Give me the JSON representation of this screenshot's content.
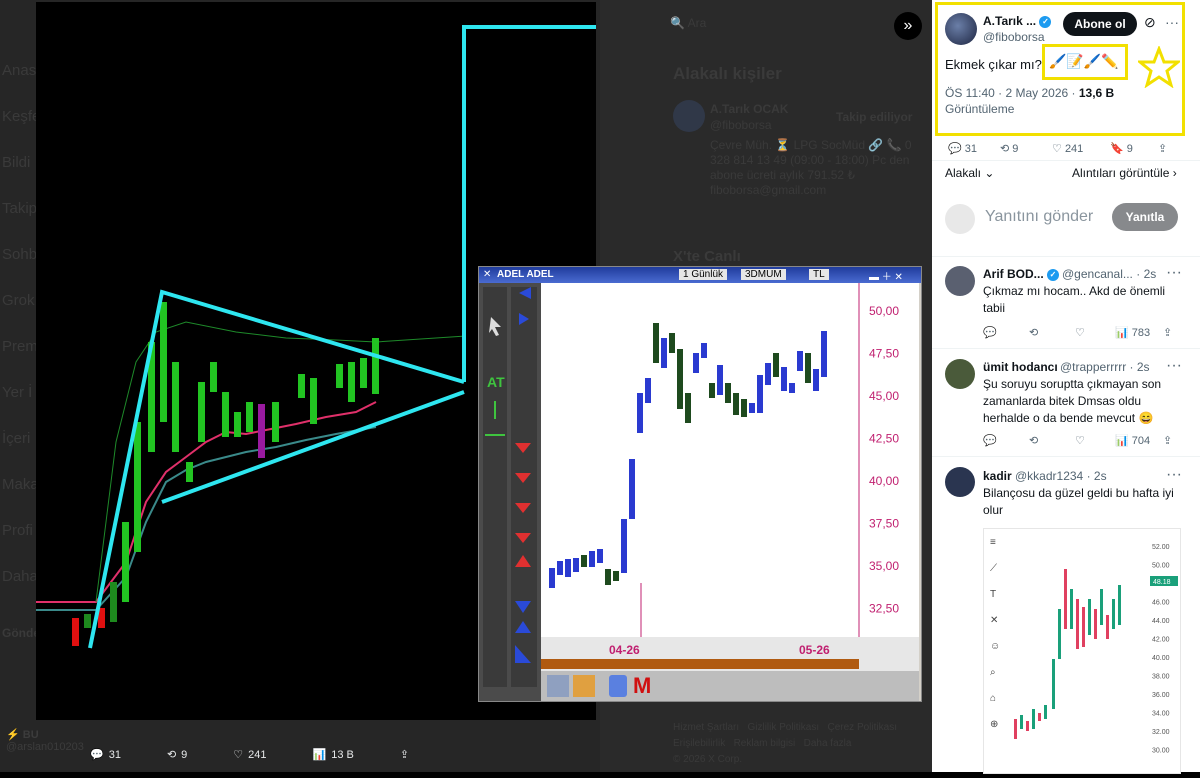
{
  "background_nav": {
    "items": [
      "Anas",
      "Keşfe",
      "Bildi",
      "Takip",
      "Sohb",
      "Grok",
      "Prem",
      "Yer İ",
      "İçeri",
      "Maka",
      "Profi",
      "Daha"
    ],
    "post_button": "Gönde"
  },
  "background_middle": {
    "search_placeholder": "Ara",
    "related_title": "Alakalı kişiler",
    "related_name": "A.Tarık OCAK",
    "related_handle": "@fiboborsa",
    "related_follow": "Takip ediliyor",
    "related_bio": "Çevre Müh. ⏳ LPG SocMüd 🔗 📞 0 328 814 13 49 (09:00 - 18:00) Pc den abone ücreti aylık 791.52 ₺ fiboborsa@gmail.com",
    "live_title": "X'te Canlı",
    "footer_links": [
      "Hizmet Şartları",
      "Gizlilik Politikası",
      "Çerez Politikası",
      "Erişilebilirlik",
      "Reklam bilgisi",
      "Daha fazla",
      "© 2026 X Corp."
    ]
  },
  "bottom_left_user": {
    "name": "BU",
    "handle": "@arslan010203"
  },
  "media_actions": {
    "replies": "31",
    "reposts": "9",
    "likes": "241",
    "views": "13 B"
  },
  "nested_window": {
    "title": "ADEL ADEL",
    "period": "1 Günlük",
    "mode": "3DMUM",
    "currency": "TL",
    "y_ticks": [
      "50,00",
      "47,50",
      "45,00",
      "42,50",
      "40,00",
      "37,50",
      "35,00",
      "32,50"
    ],
    "x_ticks": [
      "04-26",
      "05-26"
    ]
  },
  "tweet": {
    "author_name": "A.Tarık ...",
    "author_handle": "@fiboborsa",
    "subscribe_label": "Abone ol",
    "text": "Ekmek çıkar mı?",
    "emojis": "🖌️📝🖌️✏️",
    "timestamp": "ÖS 11:40 · 2 May 2026 ·",
    "views_count": "13,6 B",
    "views_label": "Görüntüleme",
    "replies": "31",
    "reposts": "9",
    "likes": "241",
    "bookmarks": "9",
    "relevance_label": "Alakalı",
    "quotes_link": "Alıntıları görüntüle"
  },
  "reply_box": {
    "placeholder": "Yanıtını gönder",
    "button": "Yanıtla"
  },
  "replies": [
    {
      "name": "Arif BOD...",
      "handle": "@gencanal...",
      "time": "· 2s",
      "text": "Çıkmaz mı hocam.. Akd de önemli tabii",
      "views": "783"
    },
    {
      "name": "ümit hodancı",
      "handle": "@trapperrrrr",
      "time": "· 2s",
      "text": "Şu soruyu soruptta çıkmayan son zamanlarda bitek Dmsas oldu herhalde o da bende mevcut 😄",
      "views": "704"
    },
    {
      "name": "kadir",
      "handle": "@kkadr1234",
      "time": "· 2s",
      "text": "Bilançosu da güzel geldi bu hafta iyi olur"
    }
  ],
  "reply_chart": {
    "y_ticks": [
      "52.00",
      "50.00",
      "48.00",
      "46.00",
      "44.00",
      "42.00",
      "40.00",
      "38.00",
      "36.00",
      "34.00",
      "32.00",
      "30.00"
    ],
    "price_label": "48.18"
  },
  "colors": {
    "highlight": "#f2e000",
    "accent_blue": "#1d9bf0",
    "chart_cyan": "#2ee6f0",
    "candle_green": "#22c422",
    "candle_red": "#e01010"
  }
}
